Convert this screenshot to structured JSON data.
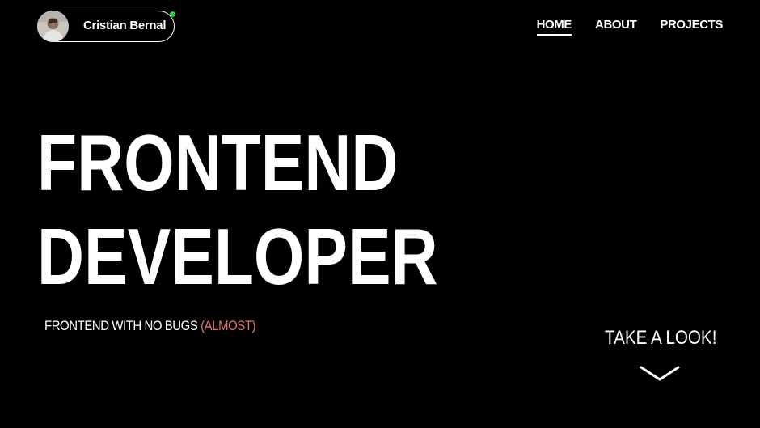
{
  "header": {
    "profile": {
      "name": "Cristian Bernal",
      "avatar_icon": "user-portrait-icon",
      "status_color": "#2ecc40"
    },
    "nav": {
      "items": [
        {
          "label": "HOME",
          "active": true
        },
        {
          "label": "ABOUT",
          "active": false
        },
        {
          "label": "PROJECTS",
          "active": false
        }
      ]
    }
  },
  "hero": {
    "title_line_1": "FRONTEND",
    "title_line_2": "DEVELOPER",
    "tagline_main": "FRONTEND WITH NO BUGS ",
    "tagline_highlight": "(ALMOST)"
  },
  "cta": {
    "label": "TAKE A LOOK!",
    "icon": "chevron-down-icon"
  },
  "colors": {
    "background": "#000000",
    "text": "#ffffff",
    "accent": "#e57373",
    "status": "#2ecc40"
  }
}
